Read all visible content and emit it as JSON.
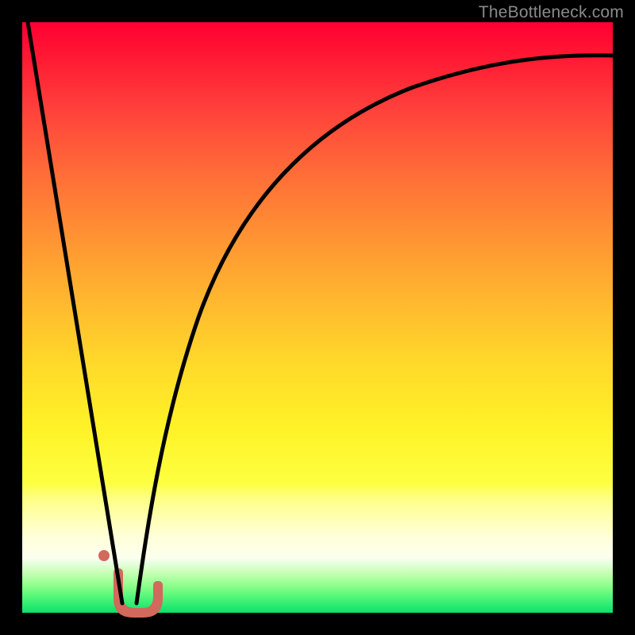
{
  "watermark": "TheBottleneck.com",
  "colors": {
    "frame": "#000000",
    "curve": "#000000",
    "marker_fill": "#d1695c",
    "marker_stroke": "#d1695c",
    "gradient_top": "#ff0033",
    "gradient_mid": "#ffd92a",
    "gradient_bottom": "#0ce06b"
  },
  "chart_data": {
    "type": "line",
    "title": "",
    "xlabel": "",
    "ylabel": "",
    "xlim": [
      0,
      100
    ],
    "ylim": [
      0,
      100
    ],
    "series": [
      {
        "name": "left-branch",
        "x": [
          0,
          3,
          6,
          9,
          12,
          14,
          15,
          16
        ],
        "values": [
          100,
          82,
          64,
          46,
          27,
          12,
          5,
          0
        ]
      },
      {
        "name": "right-branch",
        "x": [
          18,
          19,
          20,
          22,
          25,
          30,
          36,
          44,
          54,
          66,
          80,
          100
        ],
        "values": [
          0,
          6,
          14,
          28,
          44,
          60,
          71,
          79,
          85,
          89,
          92,
          94
        ]
      }
    ],
    "marker": {
      "name": "min-region-J",
      "x_range": [
        14.5,
        19
      ],
      "y_range": [
        0,
        6
      ]
    },
    "gradient_bands": [
      {
        "region": "red-orange-yellow",
        "y_range": [
          22,
          100
        ]
      },
      {
        "region": "pale-yellow",
        "y_range": [
          9,
          22
        ]
      },
      {
        "region": "green",
        "y_range": [
          0,
          9
        ]
      }
    ]
  }
}
